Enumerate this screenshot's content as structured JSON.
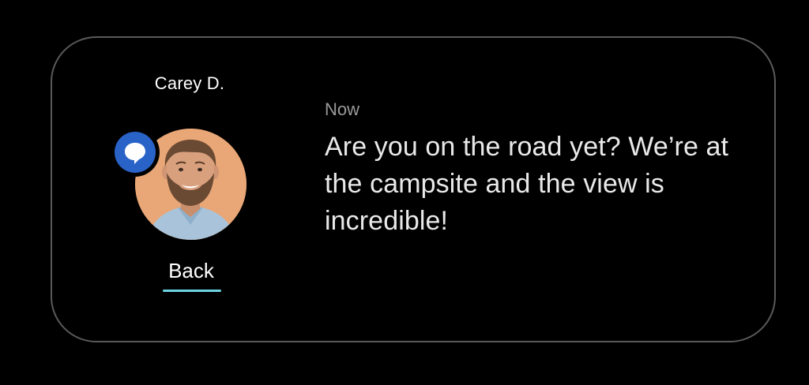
{
  "notification": {
    "sender_name": "Carey D.",
    "timestamp": "Now",
    "message": "Are you on the road yet? We’re at the campsite and the view is incredible!",
    "app_badge_icon": "message-bubble-icon",
    "avatar_icon": "contact-avatar"
  },
  "actions": {
    "back_label": "Back"
  },
  "colors": {
    "background": "#000000",
    "frame_border": "#5a5a5a",
    "badge_blue": "#2a63c8",
    "back_underline": "#6fd5e4",
    "timestamp_gray": "#9a9a9a",
    "message_text": "#e9e9e9"
  }
}
